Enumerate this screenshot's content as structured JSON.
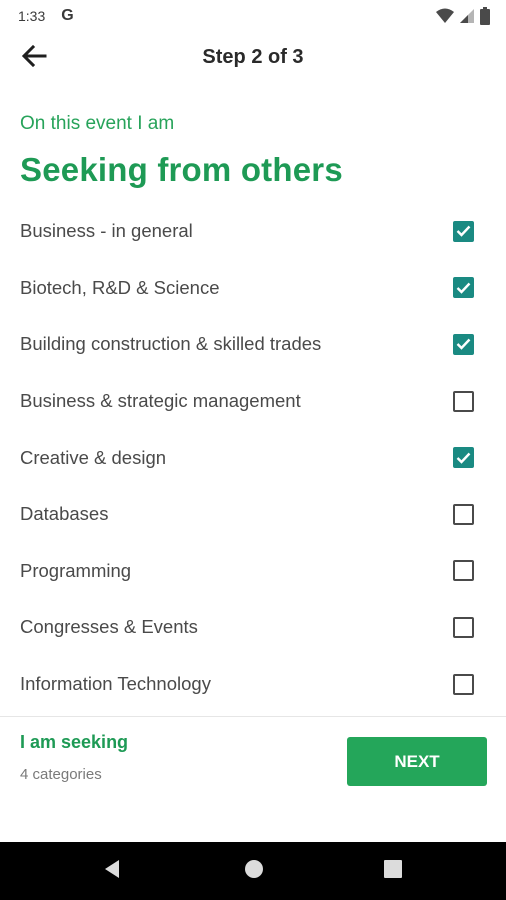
{
  "status_bar": {
    "time": "1:33",
    "g_label": "G",
    "icons": [
      "wifi-icon",
      "signal-icon",
      "battery-icon"
    ]
  },
  "app_bar": {
    "back_icon": "arrow-left-icon",
    "title": "Step 2 of 3"
  },
  "intro": {
    "subtitle": "On this event I am",
    "heading": "Seeking from others"
  },
  "categories": [
    {
      "label": "Business - in general",
      "checked": true
    },
    {
      "label": "Biotech, R&D & Science",
      "checked": true
    },
    {
      "label": "Building construction & skilled trades",
      "checked": true
    },
    {
      "label": "Business & strategic management",
      "checked": false
    },
    {
      "label": "Creative & design",
      "checked": true
    },
    {
      "label": "Databases",
      "checked": false
    },
    {
      "label": "Programming",
      "checked": false
    },
    {
      "label": "Congresses & Events",
      "checked": false
    },
    {
      "label": "Information Technology",
      "checked": false
    }
  ],
  "footer": {
    "title": "I am seeking",
    "count_text": "4 categories",
    "next_label": "NEXT"
  },
  "nav_bar": {
    "icons": [
      "back-triangle-icon",
      "home-circle-icon",
      "recents-square-icon"
    ]
  },
  "colors": {
    "accent_green": "#1e9a55",
    "button_green": "#24a65a",
    "checkbox_teal": "#1a8a82"
  }
}
